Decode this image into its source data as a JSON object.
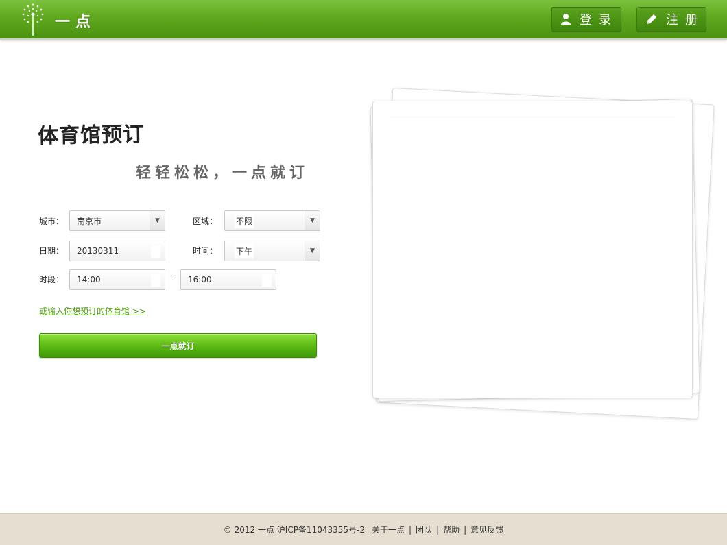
{
  "header": {
    "logo_text": "一点",
    "login_label": "登录",
    "register_label": "注册",
    "login_icon": "user-icon",
    "register_icon": "pencil-icon"
  },
  "main": {
    "title": "体育馆预订",
    "slogan": "轻轻松松，一点就订",
    "form": {
      "city_label": "城市：",
      "city_value": "南京市",
      "district_label": "区域：",
      "district_value": "不限",
      "date_label": "日期：",
      "date_value": "20130311",
      "time_label": "时间：",
      "time_value": "下午",
      "period_label": "时段：",
      "period_start": "14:00",
      "period_separator": "-",
      "period_end": "16:00"
    },
    "alt_link": "或输入你想预订的体育馆 >>",
    "book_button": "一点就订"
  },
  "footer": {
    "copyright": "© 2012 一点 沪ICP备11043355号-2",
    "links": [
      "关于一点",
      "团队",
      "帮助",
      "意见反馈"
    ]
  },
  "colors": {
    "header_green": "#5fa81e",
    "button_green": "#5dbb15",
    "link_green": "#4f9a14",
    "footer_bg": "#e6dfd1"
  }
}
